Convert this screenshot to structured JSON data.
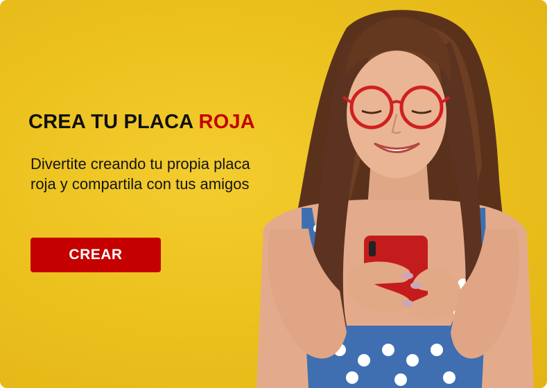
{
  "banner": {
    "headline_main": "CREA TU PLACA ",
    "headline_accent": "ROJA",
    "description": "Divertite creando tu propia placa roja y compartila con tus amigos",
    "cta_label": "CREAR"
  },
  "photo": {
    "subject": "woman-with-glasses-smiling-at-phone-icon"
  },
  "colors": {
    "background": "#ecc21f",
    "accent": "#c40000",
    "text": "#111111",
    "button_text": "#ffffff"
  }
}
